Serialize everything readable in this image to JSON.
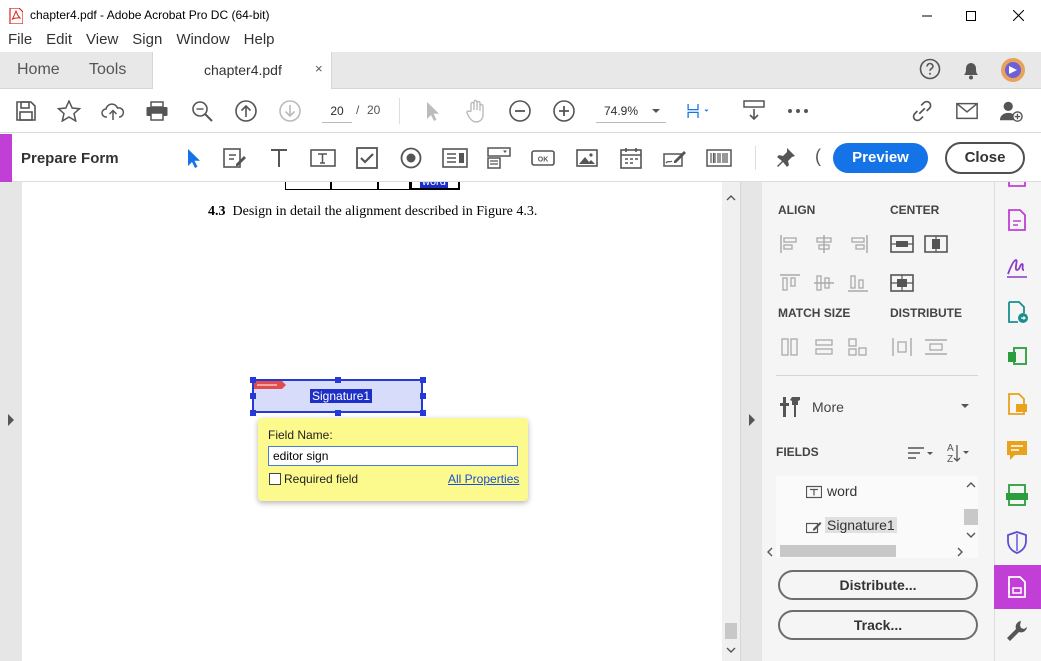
{
  "window": {
    "title": "chapter4.pdf - Adobe Acrobat Pro DC (64-bit)"
  },
  "menu": [
    "File",
    "Edit",
    "View",
    "Sign",
    "Window",
    "Help"
  ],
  "tabs": {
    "home": "Home",
    "tools": "Tools",
    "document": "chapter4.pdf",
    "close_glyph": "×"
  },
  "toolbar": {
    "page_current": "20",
    "page_separator": "/",
    "page_total": "20",
    "zoom": "74.9%"
  },
  "prepare_form": {
    "label": "Prepare Form",
    "preview": "Preview",
    "close": "Close",
    "partial_glyph": "("
  },
  "document": {
    "table_cell_text": "word",
    "figure_text_number": "4.3",
    "figure_text": "Design in detail the alignment described in Figure 4.3.",
    "signature_field_label": "Signature1"
  },
  "field_popup": {
    "label": "Field Name:",
    "value": "editor sign",
    "required_label": "Required field",
    "required_checked": false,
    "all_properties": "All Properties"
  },
  "right_panel": {
    "align": "ALIGN",
    "center": "CENTER",
    "match_size": "MATCH SIZE",
    "distribute": "DISTRIBUTE",
    "more": "More",
    "fields": "FIELDS",
    "field_items": [
      {
        "name": "word",
        "icon": "text-field-icon"
      },
      {
        "name": "Signature1",
        "icon": "signature-field-icon",
        "selected": true
      }
    ],
    "distribute_button": "Distribute...",
    "track_button": "Track..."
  },
  "colors": {
    "accent": "#c13fd6",
    "primary": "#1473e6",
    "selection": "#2538d8",
    "popup": "#fcf98d"
  }
}
